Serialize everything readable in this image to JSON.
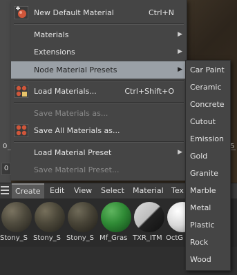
{
  "viewport": {
    "coord_left": "0",
    "coord_box": "0",
    "coord_right": "5"
  },
  "menu": {
    "new_default_material": {
      "label": "New Default Material",
      "shortcut": "Ctrl+N",
      "icon": "new-material-icon"
    },
    "materials": {
      "label": "Materials"
    },
    "extensions": {
      "label": "Extensions"
    },
    "node_material_presets": {
      "label": "Node Material Presets"
    },
    "load_materials": {
      "label": "Load Materials...",
      "shortcut": "Ctrl+Shift+O",
      "icon": "load-materials-icon"
    },
    "save_materials_as": {
      "label": "Save Materials as..."
    },
    "save_all_materials_as": {
      "label": "Save All Materials as...",
      "icon": "save-all-materials-icon"
    },
    "load_material_preset": {
      "label": "Load Material Preset"
    },
    "save_material_preset": {
      "label": "Save Material Preset..."
    }
  },
  "submenu": {
    "items": [
      "Car Paint",
      "Ceramic",
      "Concrete",
      "Cutout",
      "Emission",
      "Gold",
      "Granite",
      "Marble",
      "Metal",
      "Plastic",
      "Rock",
      "Wood"
    ]
  },
  "tabbar": {
    "tabs": [
      "Create",
      "Edit",
      "View",
      "Select",
      "Material",
      "Tex"
    ]
  },
  "thumbnails": {
    "items": [
      {
        "name": "Stony_S"
      },
      {
        "name": "Stony_S"
      },
      {
        "name": "Stony_S"
      },
      {
        "name": "Mf_Gras"
      },
      {
        "name": "TXR_ITM"
      },
      {
        "name": "OctG"
      }
    ]
  },
  "colors": {
    "menu_bg": "#454545",
    "highlight": "#9aa0a6",
    "accent_icon": "#d0563a"
  }
}
